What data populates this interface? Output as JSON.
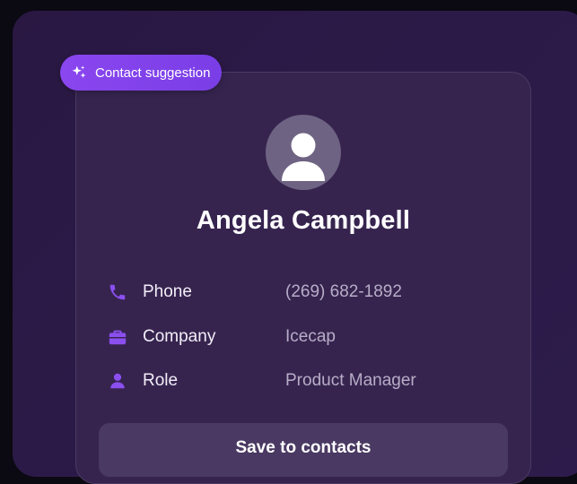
{
  "badge": {
    "label": "Contact suggestion",
    "icon": "sparkle-icon",
    "color": "#8a46ef"
  },
  "contact": {
    "avatar_icon": "person-avatar-icon",
    "name": "Angela Campbell",
    "fields": [
      {
        "icon": "phone-icon",
        "label": "Phone",
        "value": "(269) 682-1892"
      },
      {
        "icon": "briefcase-icon",
        "label": "Company",
        "value": "Icecap"
      },
      {
        "icon": "person-icon",
        "label": "Role",
        "value": "Product Manager"
      }
    ]
  },
  "actions": {
    "save_label": "Save to contacts"
  },
  "colors": {
    "panel_bg": "#2b1a47",
    "card_bg": "#36244f",
    "accent": "#8a46ef",
    "button_bg": "#4a3962"
  }
}
